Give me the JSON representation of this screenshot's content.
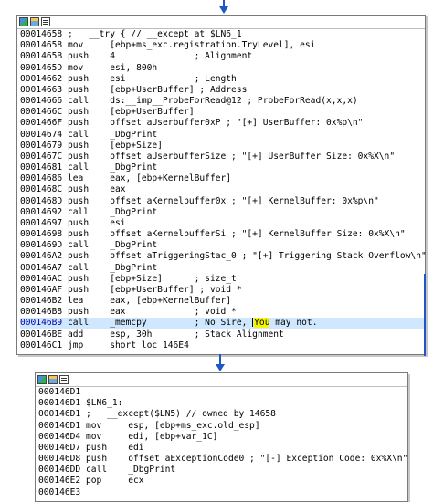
{
  "upper_block": {
    "rows": [
      {
        "addr": "00014658",
        "text": " ;   __try { // __except at $LN6_1"
      },
      {
        "addr": "00014658",
        "text": " mov     [ebp+ms_exc.registration.TryLevel], esi"
      },
      {
        "addr": "0001465B",
        "text": " push    4               ; Alignment"
      },
      {
        "addr": "0001465D",
        "text": " mov     esi, 800h"
      },
      {
        "addr": "00014662",
        "text": " push    esi             ; Length"
      },
      {
        "addr": "00014663",
        "text": " push    [ebp+UserBuffer] ; Address"
      },
      {
        "addr": "00014666",
        "text": " call    ds:__imp__ProbeForRead@12 ; ProbeForRead(x,x,x)"
      },
      {
        "addr": "0001466C",
        "text": " push    [ebp+UserBuffer]"
      },
      {
        "addr": "0001466F",
        "text": " push    offset aUserbuffer0xP ; \"[+] UserBuffer: 0x%p\\n\""
      },
      {
        "addr": "00014674",
        "text": " call    _DbgPrint"
      },
      {
        "addr": "00014679",
        "text": " push    [ebp+Size]"
      },
      {
        "addr": "0001467C",
        "text": " push    offset aUserbufferSize ; \"[+] UserBuffer Size: 0x%X\\n\""
      },
      {
        "addr": "00014681",
        "text": " call    _DbgPrint"
      },
      {
        "addr": "00014686",
        "text": " lea     eax, [ebp+KernelBuffer]"
      },
      {
        "addr": "0001468C",
        "text": " push    eax"
      },
      {
        "addr": "0001468D",
        "text": " push    offset aKernelbuffer0x ; \"[+] KernelBuffer: 0x%p\\n\""
      },
      {
        "addr": "00014692",
        "text": " call    _DbgPrint"
      },
      {
        "addr": "00014697",
        "text": " push    esi"
      },
      {
        "addr": "00014698",
        "text": " push    offset aKernelbufferSi ; \"[+] KernelBuffer Size: 0x%X\\n\""
      },
      {
        "addr": "0001469D",
        "text": " call    _DbgPrint"
      },
      {
        "addr": "000146A2",
        "text": " push    offset aTriggeringStac_0 ; \"[+] Triggering Stack Overflow\\n\""
      },
      {
        "addr": "000146A7",
        "text": " call    _DbgPrint"
      },
      {
        "addr": "000146AC",
        "text": " push    [ebp+Size]      ; size_t"
      },
      {
        "addr": "000146AF",
        "text": " push    [ebp+UserBuffer] ; void *"
      },
      {
        "addr": "000146B2",
        "text": " lea     eax, [ebp+KernelBuffer]"
      },
      {
        "addr": "000146B8",
        "text": " push    eax             ; void *"
      },
      {
        "addr": "000146B9",
        "text": " call    _memcpy         ; No Sire, ",
        "mark": "You",
        "after": " may not."
      },
      {
        "addr": "000146BE",
        "text": " add     esp, 30h        ; Stack Alignment"
      },
      {
        "addr": "000146C1",
        "text": " jmp     short loc_146E4"
      }
    ]
  },
  "lower_block": {
    "rows": [
      {
        "addr": "000146D1",
        "text": ""
      },
      {
        "addr": "000146D1",
        "text": " $LN6_1:"
      },
      {
        "addr": "000146D1",
        "text": " ;   __except($LN5) // owned by 14658"
      },
      {
        "addr": "000146D1",
        "text": " mov     esp, [ebp+ms_exc.old_esp]"
      },
      {
        "addr": "000146D4",
        "text": " mov     edi, [ebp+var_1C]"
      },
      {
        "addr": "000146D7",
        "text": " push    edi"
      },
      {
        "addr": "000146D8",
        "text": " push    offset aExceptionCode0 ; \"[-] Exception Code: 0x%X\\n\""
      },
      {
        "addr": "000146DD",
        "text": " call    _DbgPrint"
      },
      {
        "addr": "000146E2",
        "text": " pop     ecx"
      },
      {
        "addr": "000146E3",
        "text": ""
      }
    ]
  },
  "colors": {
    "edge": "#1f57c7",
    "selected_row": "#cfe8ff",
    "highlight": "#f5f500"
  },
  "icons": [
    "graph-icon",
    "picture-icon",
    "text-view-icon"
  ]
}
